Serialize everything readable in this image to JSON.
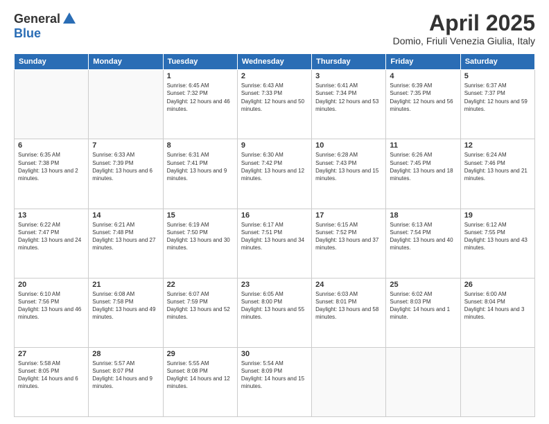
{
  "logo": {
    "general": "General",
    "blue": "Blue"
  },
  "title": "April 2025",
  "subtitle": "Domio, Friuli Venezia Giulia, Italy",
  "days_of_week": [
    "Sunday",
    "Monday",
    "Tuesday",
    "Wednesday",
    "Thursday",
    "Friday",
    "Saturday"
  ],
  "weeks": [
    [
      {
        "day": "",
        "info": ""
      },
      {
        "day": "",
        "info": ""
      },
      {
        "day": "1",
        "info": "Sunrise: 6:45 AM\nSunset: 7:32 PM\nDaylight: 12 hours and 46 minutes."
      },
      {
        "day": "2",
        "info": "Sunrise: 6:43 AM\nSunset: 7:33 PM\nDaylight: 12 hours and 50 minutes."
      },
      {
        "day": "3",
        "info": "Sunrise: 6:41 AM\nSunset: 7:34 PM\nDaylight: 12 hours and 53 minutes."
      },
      {
        "day": "4",
        "info": "Sunrise: 6:39 AM\nSunset: 7:35 PM\nDaylight: 12 hours and 56 minutes."
      },
      {
        "day": "5",
        "info": "Sunrise: 6:37 AM\nSunset: 7:37 PM\nDaylight: 12 hours and 59 minutes."
      }
    ],
    [
      {
        "day": "6",
        "info": "Sunrise: 6:35 AM\nSunset: 7:38 PM\nDaylight: 13 hours and 2 minutes."
      },
      {
        "day": "7",
        "info": "Sunrise: 6:33 AM\nSunset: 7:39 PM\nDaylight: 13 hours and 6 minutes."
      },
      {
        "day": "8",
        "info": "Sunrise: 6:31 AM\nSunset: 7:41 PM\nDaylight: 13 hours and 9 minutes."
      },
      {
        "day": "9",
        "info": "Sunrise: 6:30 AM\nSunset: 7:42 PM\nDaylight: 13 hours and 12 minutes."
      },
      {
        "day": "10",
        "info": "Sunrise: 6:28 AM\nSunset: 7:43 PM\nDaylight: 13 hours and 15 minutes."
      },
      {
        "day": "11",
        "info": "Sunrise: 6:26 AM\nSunset: 7:45 PM\nDaylight: 13 hours and 18 minutes."
      },
      {
        "day": "12",
        "info": "Sunrise: 6:24 AM\nSunset: 7:46 PM\nDaylight: 13 hours and 21 minutes."
      }
    ],
    [
      {
        "day": "13",
        "info": "Sunrise: 6:22 AM\nSunset: 7:47 PM\nDaylight: 13 hours and 24 minutes."
      },
      {
        "day": "14",
        "info": "Sunrise: 6:21 AM\nSunset: 7:48 PM\nDaylight: 13 hours and 27 minutes."
      },
      {
        "day": "15",
        "info": "Sunrise: 6:19 AM\nSunset: 7:50 PM\nDaylight: 13 hours and 30 minutes."
      },
      {
        "day": "16",
        "info": "Sunrise: 6:17 AM\nSunset: 7:51 PM\nDaylight: 13 hours and 34 minutes."
      },
      {
        "day": "17",
        "info": "Sunrise: 6:15 AM\nSunset: 7:52 PM\nDaylight: 13 hours and 37 minutes."
      },
      {
        "day": "18",
        "info": "Sunrise: 6:13 AM\nSunset: 7:54 PM\nDaylight: 13 hours and 40 minutes."
      },
      {
        "day": "19",
        "info": "Sunrise: 6:12 AM\nSunset: 7:55 PM\nDaylight: 13 hours and 43 minutes."
      }
    ],
    [
      {
        "day": "20",
        "info": "Sunrise: 6:10 AM\nSunset: 7:56 PM\nDaylight: 13 hours and 46 minutes."
      },
      {
        "day": "21",
        "info": "Sunrise: 6:08 AM\nSunset: 7:58 PM\nDaylight: 13 hours and 49 minutes."
      },
      {
        "day": "22",
        "info": "Sunrise: 6:07 AM\nSunset: 7:59 PM\nDaylight: 13 hours and 52 minutes."
      },
      {
        "day": "23",
        "info": "Sunrise: 6:05 AM\nSunset: 8:00 PM\nDaylight: 13 hours and 55 minutes."
      },
      {
        "day": "24",
        "info": "Sunrise: 6:03 AM\nSunset: 8:01 PM\nDaylight: 13 hours and 58 minutes."
      },
      {
        "day": "25",
        "info": "Sunrise: 6:02 AM\nSunset: 8:03 PM\nDaylight: 14 hours and 1 minute."
      },
      {
        "day": "26",
        "info": "Sunrise: 6:00 AM\nSunset: 8:04 PM\nDaylight: 14 hours and 3 minutes."
      }
    ],
    [
      {
        "day": "27",
        "info": "Sunrise: 5:58 AM\nSunset: 8:05 PM\nDaylight: 14 hours and 6 minutes."
      },
      {
        "day": "28",
        "info": "Sunrise: 5:57 AM\nSunset: 8:07 PM\nDaylight: 14 hours and 9 minutes."
      },
      {
        "day": "29",
        "info": "Sunrise: 5:55 AM\nSunset: 8:08 PM\nDaylight: 14 hours and 12 minutes."
      },
      {
        "day": "30",
        "info": "Sunrise: 5:54 AM\nSunset: 8:09 PM\nDaylight: 14 hours and 15 minutes."
      },
      {
        "day": "",
        "info": ""
      },
      {
        "day": "",
        "info": ""
      },
      {
        "day": "",
        "info": ""
      }
    ]
  ]
}
